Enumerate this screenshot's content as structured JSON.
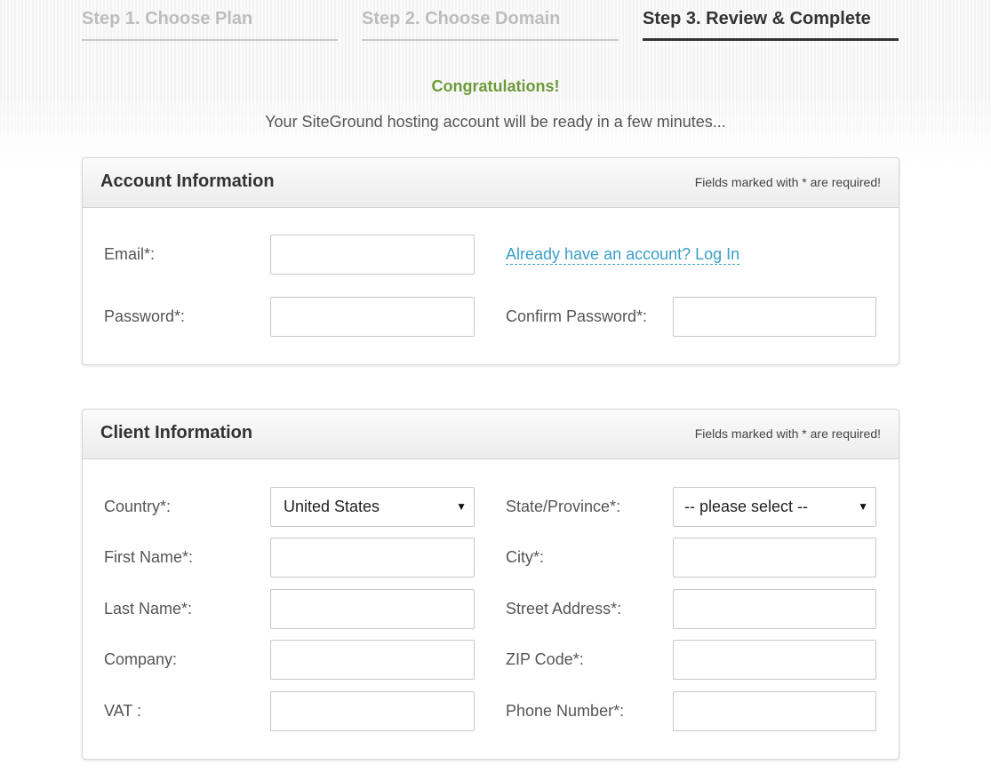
{
  "steps": [
    {
      "label": "Step 1. Choose Plan",
      "active": false
    },
    {
      "label": "Step 2. Choose Domain",
      "active": false
    },
    {
      "label": "Step 3. Review & Complete",
      "active": true
    }
  ],
  "congrats": "Congratulations!",
  "subtext": "Your SiteGround hosting account will be ready in a few minutes...",
  "account": {
    "title": "Account Information",
    "required_note": "Fields marked with * are required!",
    "email_label": "Email*:",
    "email_value": "",
    "login_link": "Already have an account? Log In",
    "password_label": "Password*:",
    "password_value": "",
    "confirm_password_label": "Confirm Password*:",
    "confirm_password_value": ""
  },
  "client": {
    "title": "Client Information",
    "required_note": "Fields marked with * are required!",
    "country_label": "Country*:",
    "country_value": "United States",
    "state_label": "State/Province*:",
    "state_value": "-- please select --",
    "first_name_label": "First Name*:",
    "first_name_value": "",
    "city_label": "City*:",
    "city_value": "",
    "last_name_label": "Last Name*:",
    "last_name_value": "",
    "street_label": "Street Address*:",
    "street_value": "",
    "company_label": "Company:",
    "company_value": "",
    "zip_label": "ZIP Code*:",
    "zip_value": "",
    "vat_label": "VAT :",
    "vat_value": "",
    "phone_label": "Phone Number*:",
    "phone_value": ""
  },
  "colors": {
    "accent_green": "#6e9a3a",
    "link_blue": "#3a9ec7",
    "inactive_step": "#bdbdbd"
  },
  "icons": {
    "select_arrow": "dropdown-arrow-icon"
  }
}
